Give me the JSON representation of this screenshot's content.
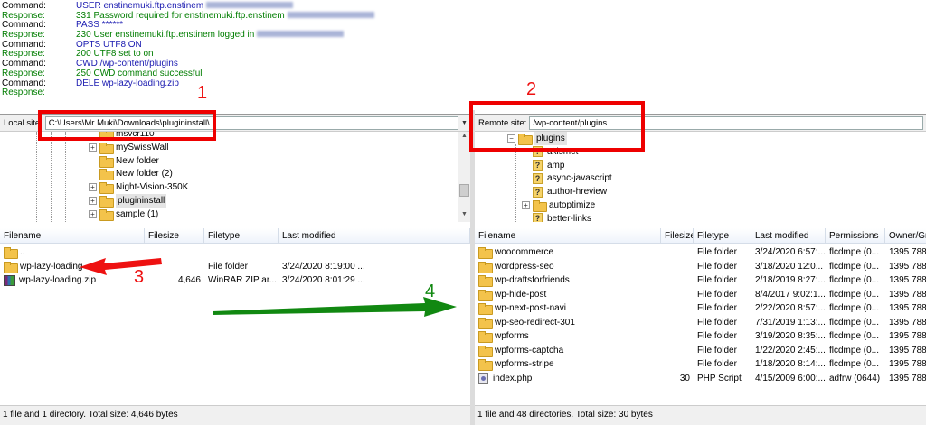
{
  "log": [
    {
      "type": "cmd",
      "label": "Command:",
      "message": "USER enstinemuki.ftp.enstinem"
    },
    {
      "type": "resp",
      "label": "Response:",
      "message": "331 Password required for enstinemuki.ftp.enstinem"
    },
    {
      "type": "cmd",
      "label": "Command:",
      "message": "PASS ******"
    },
    {
      "type": "resp",
      "label": "Response:",
      "message": "230 User enstinemuki.ftp.enstinem logged in"
    },
    {
      "type": "cmd",
      "label": "Command:",
      "message": "OPTS UTF8 ON"
    },
    {
      "type": "resp",
      "label": "Response:",
      "message": "200 UTF8 set to on"
    },
    {
      "type": "status",
      "label": "Status:",
      "message": "Connected"
    },
    {
      "type": "cmd",
      "label": "Command:",
      "message": "CWD /wp-content/plugins"
    },
    {
      "type": "resp",
      "label": "Response:",
      "message": "250 CWD command successful"
    },
    {
      "type": "cmd",
      "label": "Command:",
      "message": "DELE wp-lazy-loading.zip"
    },
    {
      "type": "resp",
      "label": "Response:",
      "message": ""
    }
  ],
  "local": {
    "site_label": "Local site:",
    "path": "C:\\Users\\Mr Muki\\Downloads\\plugininstall\\",
    "tree": [
      {
        "name": "msvcr110",
        "expandable": false
      },
      {
        "name": "mySwissWall",
        "expandable": true
      },
      {
        "name": "New folder",
        "expandable": false
      },
      {
        "name": "New folder (2)",
        "expandable": false
      },
      {
        "name": "Night-Vision-350K",
        "expandable": true
      },
      {
        "name": "plugininstall",
        "expandable": true
      },
      {
        "name": "sample (1)",
        "expandable": true
      }
    ],
    "columns": {
      "filename": "Filename",
      "filesize": "Filesize",
      "filetype": "Filetype",
      "modified": "Last modified"
    },
    "files": [
      {
        "name": "..",
        "size": "",
        "type": "",
        "modified": "",
        "icon": "folder"
      },
      {
        "name": "wp-lazy-loading",
        "size": "",
        "type": "File folder",
        "modified": "3/24/2020 8:19:00 ...",
        "icon": "folder"
      },
      {
        "name": "wp-lazy-loading.zip",
        "size": "4,646",
        "type": "WinRAR ZIP ar...",
        "modified": "3/24/2020 8:01:29 ...",
        "icon": "zip"
      }
    ],
    "status": "1 file and 1 directory. Total size: 4,646 bytes"
  },
  "remote": {
    "site_label": "Remote site:",
    "path": "/wp-content/plugins",
    "tree": [
      {
        "name": "plugins",
        "kind": "folder"
      },
      {
        "name": "akismet",
        "kind": "unknown"
      },
      {
        "name": "amp",
        "kind": "unknown"
      },
      {
        "name": "async-javascript",
        "kind": "unknown"
      },
      {
        "name": "author-hreview",
        "kind": "unknown"
      },
      {
        "name": "autoptimize",
        "kind": "folder"
      },
      {
        "name": "better-links",
        "kind": "unknown"
      }
    ],
    "columns": {
      "filename": "Filename",
      "filesize": "Filesize",
      "filetype": "Filetype",
      "modified": "Last modified",
      "permissions": "Permissions",
      "owner": "Owner/Gr"
    },
    "files": [
      {
        "name": "woocommerce",
        "size": "",
        "type": "File folder",
        "modified": "3/24/2020 6:57:...",
        "perm": "flcdmpe (0...",
        "owner": "1395 788",
        "icon": "folder"
      },
      {
        "name": "wordpress-seo",
        "size": "",
        "type": "File folder",
        "modified": "3/18/2020 12:0...",
        "perm": "flcdmpe (0...",
        "owner": "1395 788",
        "icon": "folder"
      },
      {
        "name": "wp-draftsforfriends",
        "size": "",
        "type": "File folder",
        "modified": "2/18/2019 8:27:...",
        "perm": "flcdmpe (0...",
        "owner": "1395 788",
        "icon": "folder"
      },
      {
        "name": "wp-hide-post",
        "size": "",
        "type": "File folder",
        "modified": "8/4/2017 9:02:1...",
        "perm": "flcdmpe (0...",
        "owner": "1395 788",
        "icon": "folder"
      },
      {
        "name": "wp-next-post-navi",
        "size": "",
        "type": "File folder",
        "modified": "2/22/2020 8:57:...",
        "perm": "flcdmpe (0...",
        "owner": "1395 788",
        "icon": "folder"
      },
      {
        "name": "wp-seo-redirect-301",
        "size": "",
        "type": "File folder",
        "modified": "7/31/2019 1:13:...",
        "perm": "flcdmpe (0...",
        "owner": "1395 788",
        "icon": "folder"
      },
      {
        "name": "wpforms",
        "size": "",
        "type": "File folder",
        "modified": "3/19/2020 8:35:...",
        "perm": "flcdmpe (0...",
        "owner": "1395 788",
        "icon": "folder"
      },
      {
        "name": "wpforms-captcha",
        "size": "",
        "type": "File folder",
        "modified": "1/22/2020 2:45:...",
        "perm": "flcdmpe (0...",
        "owner": "1395 788",
        "icon": "folder"
      },
      {
        "name": "wpforms-stripe",
        "size": "",
        "type": "File folder",
        "modified": "1/18/2020 8:14:...",
        "perm": "flcdmpe (0...",
        "owner": "1395 788",
        "icon": "folder"
      },
      {
        "name": "index.php",
        "size": "30",
        "type": "PHP Script",
        "modified": "4/15/2009 6:00:...",
        "perm": "adfrw (0644)",
        "owner": "1395 788",
        "icon": "php"
      }
    ],
    "status": "1 file and 48 directories. Total size: 30 bytes"
  },
  "annotations": {
    "n1": "1",
    "n2": "2",
    "n3": "3",
    "n4": "4"
  },
  "colors": {
    "annotation_red": "#ee0000",
    "annotation_green": "#118811"
  }
}
